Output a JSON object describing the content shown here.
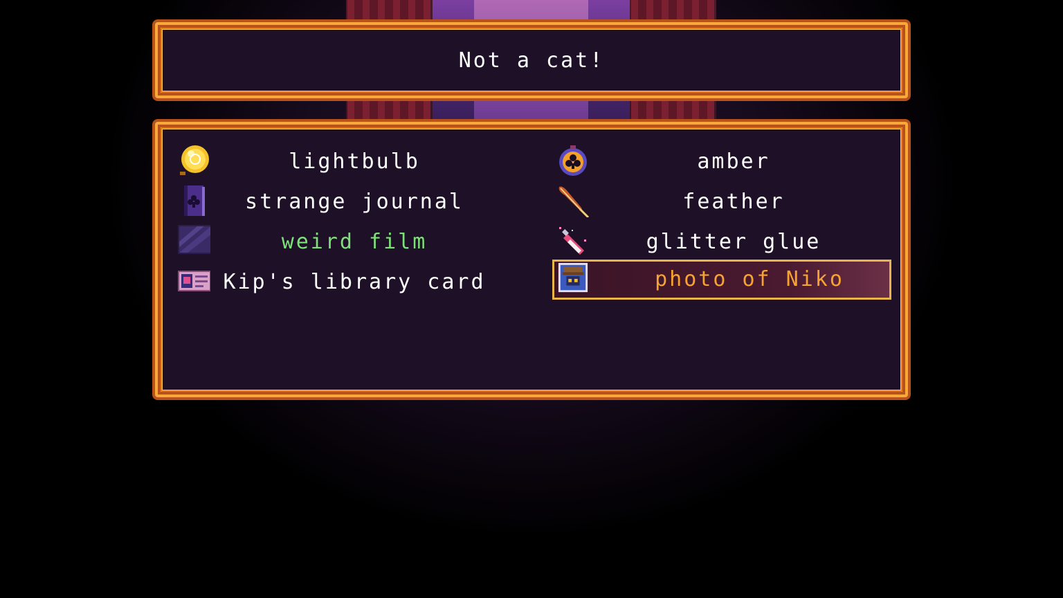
{
  "message": {
    "text": "Not a cat!"
  },
  "inventory": {
    "items": [
      {
        "label": "lightbulb",
        "icon": "lightbulb-icon",
        "column": 0,
        "row": 0,
        "selected": false
      },
      {
        "label": "strange journal",
        "icon": "journal-icon",
        "column": 0,
        "row": 1,
        "selected": false
      },
      {
        "label": "weird film",
        "icon": "film-icon",
        "column": 0,
        "row": 2,
        "selected": false,
        "color": "#7ee07a"
      },
      {
        "label": "Kip's library card",
        "icon": "library-card-icon",
        "column": 0,
        "row": 3,
        "selected": false
      },
      {
        "label": "amber",
        "icon": "amber-icon",
        "column": 1,
        "row": 0,
        "selected": false
      },
      {
        "label": "feather",
        "icon": "feather-icon",
        "column": 1,
        "row": 1,
        "selected": false
      },
      {
        "label": "glitter glue",
        "icon": "glitter-glue-icon",
        "column": 1,
        "row": 2,
        "selected": false
      },
      {
        "label": "photo of Niko",
        "icon": "niko-photo-icon",
        "column": 1,
        "row": 3,
        "selected": true
      }
    ]
  },
  "colors": {
    "border": "#f9a83a",
    "panel_bg": "#1e1026",
    "text": "#ffffff",
    "highlight_text": "#f7a332",
    "special_text": "#7ee07a"
  }
}
